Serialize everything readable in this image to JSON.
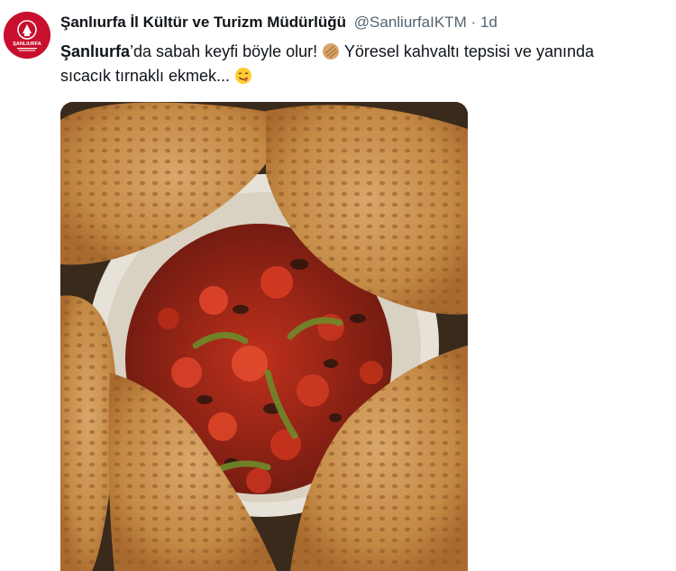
{
  "tweet": {
    "author_name": "Şanlıurfa İl Kültür ve Turizm Müdürlüğü",
    "handle": "@SanliurfaIKTM",
    "separator": "·",
    "time": "1d",
    "text_bold": "Şanlıurfa",
    "text_line1_rest": "’da sabah keyfi böyle olur!",
    "text_after_emoji": " Yöresel kahvaltı tepsisi ve yanında",
    "text_line2": "sıcacık tırnaklı ekmek...",
    "emoji_1": "bread-emoji",
    "emoji_2": "yum-face-emoji"
  },
  "avatar": {
    "brand_color": "#c8102e",
    "logo_text": "ŞANLIURFA"
  },
  "media": {
    "image": "photo-breakfast-tray-with-roasted-vegetables-and-tirnakli-bread"
  }
}
